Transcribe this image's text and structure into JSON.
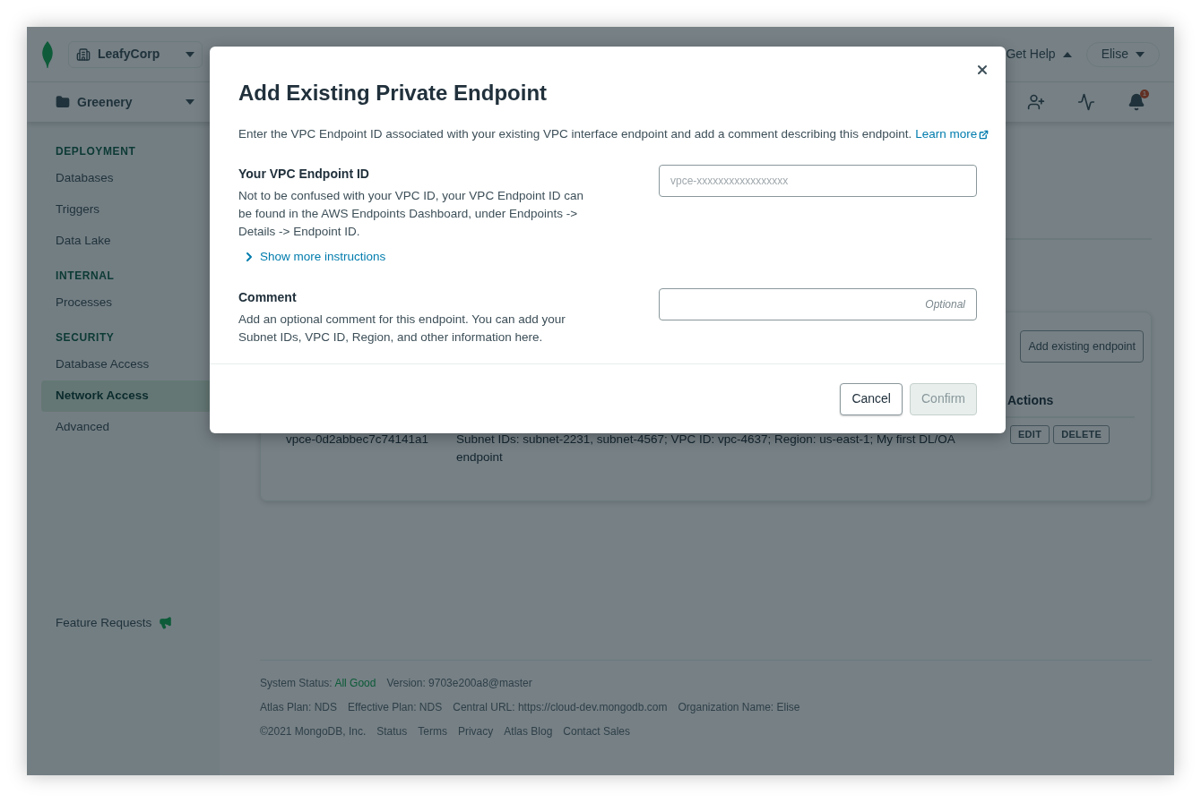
{
  "top_bar": {
    "organization": "LeafyCorp",
    "help": "Get Help",
    "user": "Elise"
  },
  "project_bar": {
    "project": "Greenery",
    "notification_count": "1"
  },
  "sidebar": {
    "sections": [
      {
        "heading": "DEPLOYMENT",
        "items": [
          {
            "label": "Databases",
            "selected": false
          },
          {
            "label": "Triggers",
            "selected": false
          },
          {
            "label": "Data Lake",
            "selected": false
          }
        ]
      },
      {
        "heading": "INTERNAL",
        "items": [
          {
            "label": "Processes",
            "selected": false
          }
        ]
      },
      {
        "heading": "SECURITY",
        "items": [
          {
            "label": "Database Access",
            "selected": false
          },
          {
            "label": "Network Access",
            "selected": true
          },
          {
            "label": "Advanced",
            "selected": false
          }
        ]
      }
    ],
    "feature_requests": "Feature Requests"
  },
  "endpoints": {
    "add_button": "Add existing endpoint",
    "columns": [
      "Actions"
    ],
    "rows": [
      {
        "endpoint_id": "vpce-0d2abbec7c74141a1",
        "comment": "Subnet IDs: subnet-2231, subnet-4567; VPC ID: vpc-4637; Region: us-east-1; My first DL/OA endpoint",
        "actions": [
          "EDIT",
          "DELETE"
        ]
      }
    ]
  },
  "footer": {
    "status_label": "System Status:",
    "status_value": "All Good",
    "version": "Version: 9703e200a8@master",
    "info": [
      "Atlas Plan: NDS",
      "Effective Plan: NDS",
      "Central URL: https://cloud-dev.mongodb.com",
      "Organization Name: Elise"
    ],
    "copyright": "©2021 MongoDB, Inc.",
    "links": [
      "Status",
      "Terms",
      "Privacy",
      "Atlas Blog",
      "Contact Sales"
    ]
  },
  "dialog": {
    "title": "Add Existing Private Endpoint",
    "description": "Enter the VPC Endpoint ID associated with your existing VPC interface endpoint and add a comment describing this endpoint.",
    "learn_more": "Learn more",
    "fields": [
      {
        "kind": "required",
        "label": "Your VPC Endpoint ID",
        "help": "Not to be confused with your VPC ID, your VPC Endpoint ID can be found in the AWS Endpoints Dashboard, under Endpoints -> Details -> Endpoint ID.",
        "expander": "Show more instructions",
        "placeholder": "vpce-xxxxxxxxxxxxxxxxx"
      },
      {
        "kind": "optional",
        "label": "Comment",
        "help": "Add an optional comment for this endpoint. You can add your Subnet IDs, VPC ID, Region, and other information here.",
        "placeholder": "Optional"
      }
    ],
    "cancel": "Cancel",
    "confirm": {
      "label": "Confirm",
      "disabled": true
    }
  }
}
